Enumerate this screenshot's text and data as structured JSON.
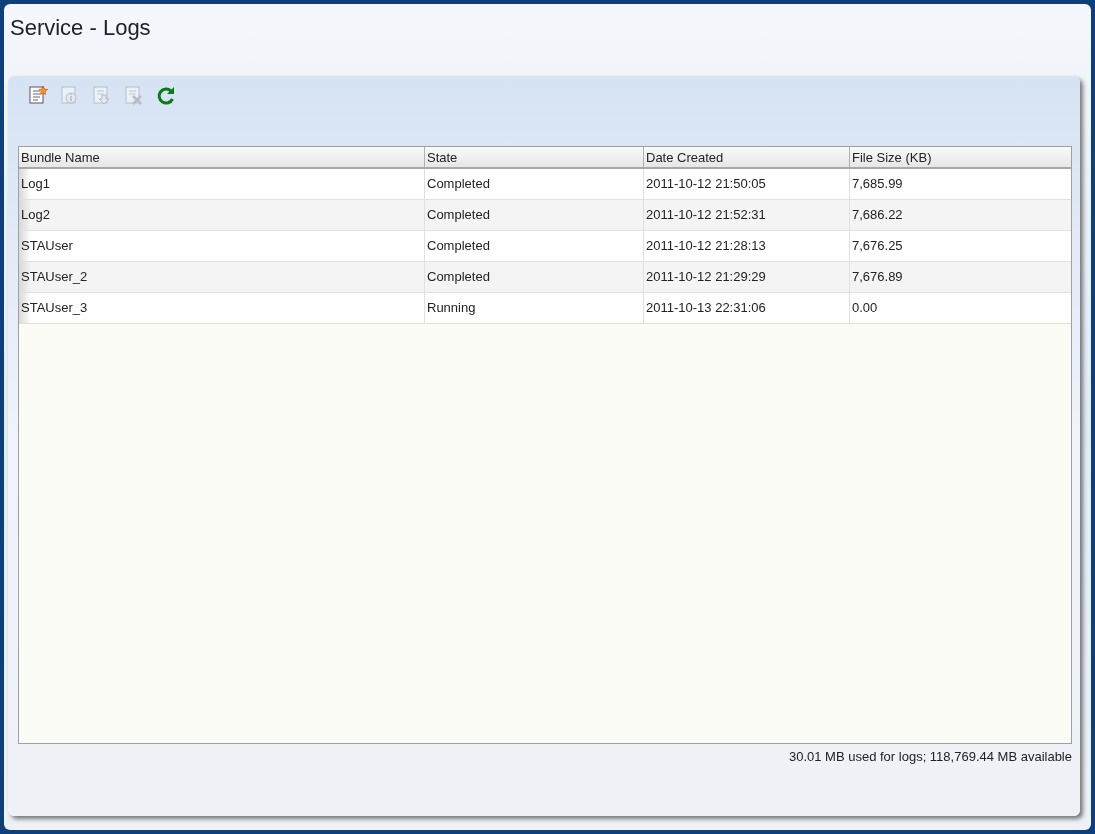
{
  "window": {
    "title": "Service - Logs"
  },
  "toolbar": [
    {
      "kind": "new",
      "disabled": false
    },
    {
      "kind": "info",
      "disabled": true
    },
    {
      "kind": "download",
      "disabled": true
    },
    {
      "kind": "delete",
      "disabled": true
    },
    {
      "kind": "refresh",
      "disabled": false
    }
  ],
  "table": {
    "columns": [
      "Bundle Name",
      "State",
      "Date Created",
      "File Size (KB)"
    ],
    "rows": [
      [
        "Log1",
        "Completed",
        "2011-10-12 21:50:05",
        "7,685.99"
      ],
      [
        "Log2",
        "Completed",
        "2011-10-12 21:52:31",
        "7,686.22"
      ],
      [
        "STAUser",
        "Completed",
        "2011-10-12 21:28:13",
        "7,676.25"
      ],
      [
        "STAUser_2",
        "Completed",
        "2011-10-12 21:29:29",
        "7,676.89"
      ],
      [
        "STAUser_3",
        "Running",
        "2011-10-13 22:31:06",
        "0.00"
      ]
    ]
  },
  "status_bar": "30.01 MB used for logs; 118,769.44 MB available"
}
